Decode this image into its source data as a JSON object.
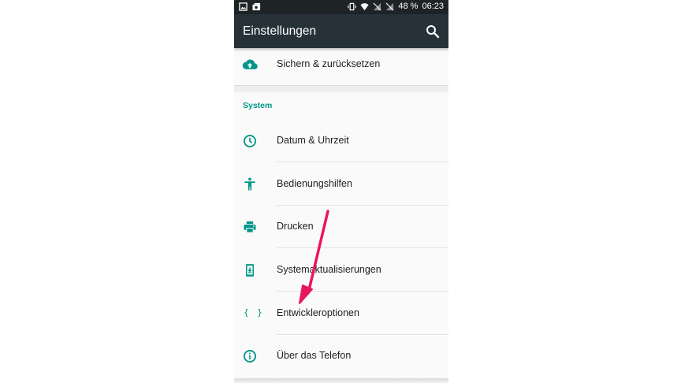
{
  "statusbar": {
    "battery": "48 %",
    "time": "06:23",
    "left_icons": [
      "image-notification-icon",
      "photo-notification-icon"
    ],
    "right_icons": [
      "vibrate-icon",
      "wifi-icon",
      "no-sim-icon",
      "no-sim-icon"
    ]
  },
  "appbar": {
    "title": "Einstellungen",
    "search_icon": "search-icon"
  },
  "top_item": {
    "label": "Sichern & zurücksetzen",
    "icon": "cloud-upload-icon"
  },
  "section": {
    "header": "System",
    "items": [
      {
        "label": "Datum & Uhrzeit",
        "icon": "clock-icon"
      },
      {
        "label": "Bedienungshilfen",
        "icon": "accessibility-icon"
      },
      {
        "label": "Drucken",
        "icon": "print-icon"
      },
      {
        "label": "Systemaktualisierungen",
        "icon": "system-update-icon"
      },
      {
        "label": "Entwickleroptionen",
        "icon": "braces-icon",
        "glyph": "{ }"
      },
      {
        "label": "Über das Telefon",
        "icon": "info-icon"
      }
    ]
  },
  "colors": {
    "accent": "#009688",
    "appbar": "#263238",
    "statusbar": "#1e2326",
    "annotation_arrow": "#e8175d"
  }
}
